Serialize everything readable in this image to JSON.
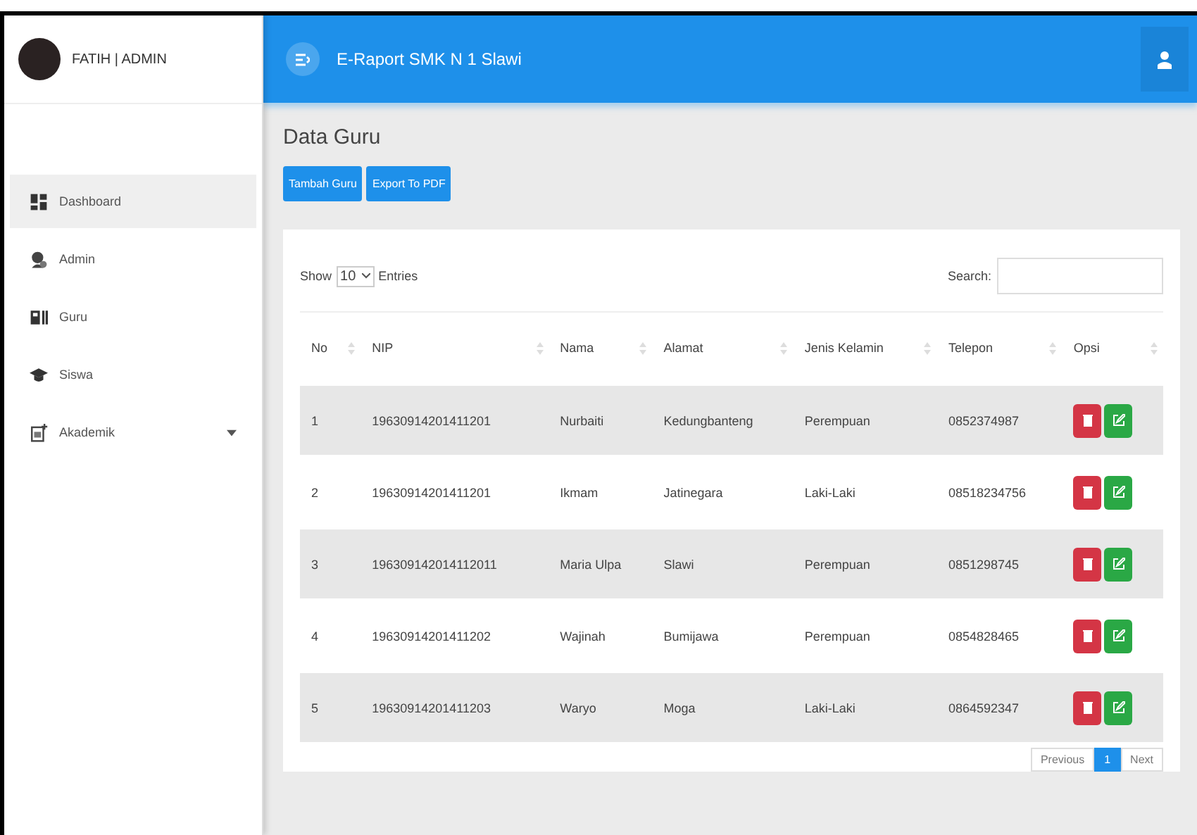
{
  "sidebar": {
    "user": "FATIH | ADMIN",
    "items": [
      {
        "label": "Dashboard",
        "kind": "link",
        "selected": true
      },
      {
        "label": "Admin",
        "kind": "link",
        "selected": false
      },
      {
        "label": "Guru",
        "kind": "link",
        "selected": false
      },
      {
        "label": "Siswa",
        "kind": "link",
        "selected": false
      },
      {
        "label": "Akademik",
        "kind": "dropdown",
        "selected": false
      }
    ]
  },
  "header": {
    "title": "E-Raport SMK N 1 Slawi"
  },
  "page_title": "Data Guru",
  "buttons": [
    "Tambah Guru",
    "Export To PDF"
  ],
  "length_control": {
    "label_before": "Show",
    "value": "10",
    "label_after": "Entries"
  },
  "search": {
    "label": "Search:"
  },
  "table": {
    "columns": [
      "No",
      "NIP",
      "Nama",
      "Alamat",
      "Jenis Kelamin",
      "Telepon",
      "Opsi"
    ],
    "rows": [
      [
        "1",
        "19630914201411201",
        "Nurbaiti",
        "Kedungbanteng",
        "Perempuan",
        "0852374987"
      ],
      [
        "2",
        "19630914201411201",
        "Ikmam",
        "Jatinegara",
        "Laki-Laki",
        "08518234756"
      ],
      [
        "3",
        "196309142014112011",
        "Maria Ulpa",
        "Slawi",
        "Perempuan",
        "0851298745"
      ],
      [
        "4",
        "19630914201411202",
        "Wajinah",
        "Bumijawa",
        "Perempuan",
        "0854828465"
      ],
      [
        "5",
        "19630914201411203",
        "Waryo",
        "Moga",
        "Laki-Laki",
        "0864592347"
      ]
    ]
  },
  "pagination": [
    {
      "label": "Previous",
      "selected": false
    },
    {
      "label": "1",
      "selected": true
    },
    {
      "label": "Next",
      "selected": false
    }
  ]
}
